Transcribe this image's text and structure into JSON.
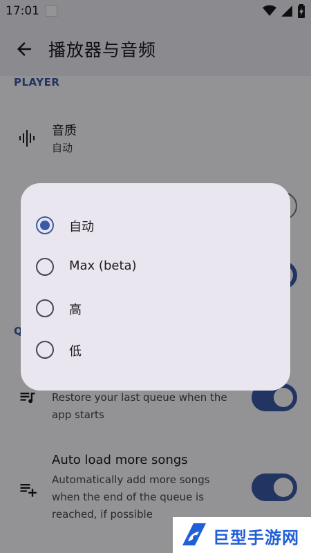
{
  "status_bar": {
    "time": "17:01"
  },
  "app_bar": {
    "title": "播放器与音频"
  },
  "sections": {
    "player_header": "PLAYER",
    "queue_header_partial": "Q"
  },
  "settings": {
    "audio_quality": {
      "title": "音质",
      "value": "自动"
    },
    "restore_queue": {
      "subtitle": "Restore your last queue when the app starts"
    },
    "auto_load": {
      "title": "Auto load more songs",
      "subtitle": "Automatically add more songs when the end of the queue is reached, if possible"
    }
  },
  "dialog": {
    "options": [
      {
        "label": "自动",
        "selected": true
      },
      {
        "label": "Max (beta)",
        "selected": false
      },
      {
        "label": "高",
        "selected": false
      },
      {
        "label": "低",
        "selected": false
      }
    ]
  },
  "watermark": {
    "text": "巨型手游网"
  },
  "colors": {
    "accent": "#3b5ba9",
    "surface": "#fdfbff",
    "dialog_bg": "#e9e6f0",
    "watermark_blue": "#1f5fd8"
  },
  "icons": {
    "back": "arrow-left-icon",
    "quality": "waveform-icon",
    "queue": "queue-music-icon",
    "playlist_add": "playlist-add-icon"
  }
}
